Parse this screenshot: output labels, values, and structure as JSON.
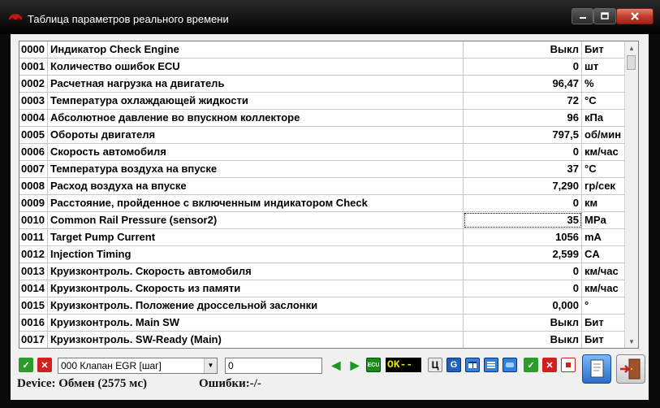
{
  "window": {
    "title": "Таблица параметров реального времени",
    "buttons": {
      "minimize": "▬",
      "maximize": "☐",
      "close": "✕"
    }
  },
  "table": {
    "rows": [
      {
        "id": "0000",
        "name": "Индикатор Check Engine",
        "value": "Выкл",
        "unit": "Бит"
      },
      {
        "id": "0001",
        "name": "Количество ошибок ECU",
        "value": "0",
        "unit": "шт"
      },
      {
        "id": "0002",
        "name": "Расчетная нагрузка на двигатель",
        "value": "96,47",
        "unit": "%"
      },
      {
        "id": "0003",
        "name": "Температура охлаждающей жидкости",
        "value": "72",
        "unit": "°C"
      },
      {
        "id": "0004",
        "name": "Абсолютное давление во впускном коллекторе",
        "value": "96",
        "unit": "кПа"
      },
      {
        "id": "0005",
        "name": "Обороты двигателя",
        "value": "797,5",
        "unit": "об/мин"
      },
      {
        "id": "0006",
        "name": "Скорость автомобиля",
        "value": "0",
        "unit": "км/час"
      },
      {
        "id": "0007",
        "name": "Температура воздуха на впуске",
        "value": "37",
        "unit": "°C"
      },
      {
        "id": "0008",
        "name": "Расход воздуха на впуске",
        "value": "7,290",
        "unit": "гр/сек"
      },
      {
        "id": "0009",
        "name": "Расстояние, пройденное с включенным индикатором Check",
        "value": "0",
        "unit": "км"
      },
      {
        "id": "0010",
        "name": "Common Rail Pressure (sensor2)",
        "value": "35",
        "unit": "MPa"
      },
      {
        "id": "0011",
        "name": "Target Pump Current",
        "value": "1056",
        "unit": "mA"
      },
      {
        "id": "0012",
        "name": "Injection Timing",
        "value": "2,599",
        "unit": "CA"
      },
      {
        "id": "0013",
        "name": "Круизконтроль. Скорость автомобиля",
        "value": "0",
        "unit": "км/час"
      },
      {
        "id": "0014",
        "name": "Круизконтроль. Скорость из памяти",
        "value": "0",
        "unit": "км/час"
      },
      {
        "id": "0015",
        "name": "Круизконтроль. Положение дроссельной заслонки",
        "value": "0,000",
        "unit": "°"
      },
      {
        "id": "0016",
        "name": "Круизконтроль. Main SW",
        "value": "Выкл",
        "unit": "Бит"
      },
      {
        "id": "0017",
        "name": "Круизконтроль. SW-Ready (Main)",
        "value": "Выкл",
        "unit": "Бит"
      }
    ]
  },
  "toolbar": {
    "selected_param": "000 Клапан EGR [шаг]",
    "value_input": "0",
    "ok_indicator": "OK--",
    "c_button": "Ц",
    "g_button": "G"
  },
  "status": {
    "device": "Device: Обмен (2575 мс)",
    "errors": "Ошибки:-/-"
  },
  "colors": {
    "titlebar": "#111111",
    "close": "#c0392b",
    "ok_text": "#e6e600",
    "green": "#2e9a2e",
    "red": "#d02020",
    "blue": "#2060c0"
  },
  "icons": [
    "car-icon",
    "check-icon",
    "cancel-icon",
    "arrow-left-icon",
    "arrow-right-icon",
    "ecu-icon",
    "document-icon",
    "exit-door-icon"
  ]
}
